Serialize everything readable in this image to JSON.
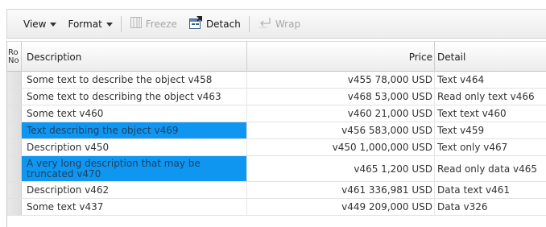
{
  "toolbar": {
    "view_label": "View",
    "format_label": "Format",
    "freeze_label": "Freeze",
    "detach_label": "Detach",
    "wrap_label": "Wrap"
  },
  "table": {
    "headers": {
      "rowno": "Ro No",
      "description": "Description",
      "price": "Price",
      "detail": "Detail"
    },
    "rows": [
      {
        "description": "Some text to describe the object v458",
        "price": "v455 78,000 USD",
        "detail": "Text v464",
        "selected": false
      },
      {
        "description": "Some text to describing the object v463",
        "price": "v468 53,000 USD",
        "detail": "Read only text v466",
        "selected": false
      },
      {
        "description": "Some text v460",
        "price": "v460 21,000 USD",
        "detail": "Text text v460",
        "selected": false
      },
      {
        "description": "Text describing the object v469",
        "price": "v456 583,000 USD",
        "detail": "Text v459",
        "selected": true
      },
      {
        "description": "Description v450",
        "price": "v450 1,000,000 USD",
        "detail": "Text only v467",
        "selected": false
      },
      {
        "description": "A very long description that may be truncated v470",
        "price": "v465 1,200 USD",
        "detail": "Read only data v465",
        "selected": true
      },
      {
        "description": "Description v462",
        "price": "v461 336,981 USD",
        "detail": "Data text v461",
        "selected": false
      },
      {
        "description": "Some text v437",
        "price": "v449 209,000 USD",
        "detail": "Data v326",
        "selected": false
      }
    ]
  },
  "colors": {
    "selection": "#0f96f0",
    "toolbar_bg": "#f2f2f2"
  }
}
